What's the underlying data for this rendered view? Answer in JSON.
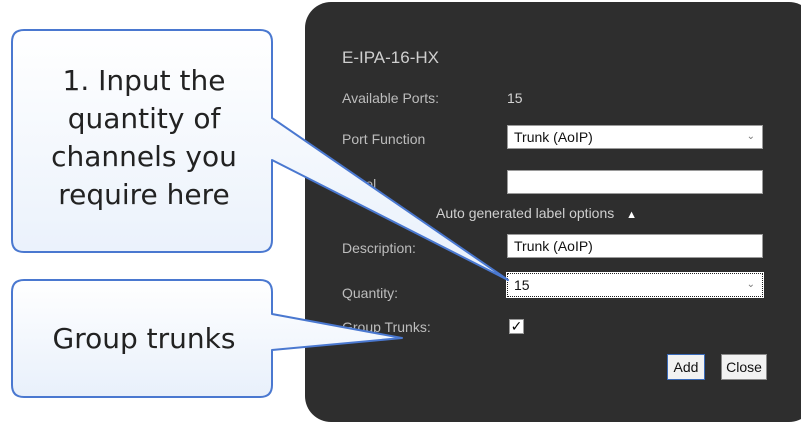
{
  "dialog": {
    "device_name": "E-IPA-16-HX",
    "available_ports_label": "Available Ports:",
    "available_ports_value": "15",
    "port_function_label": "Port Function",
    "port_function_value": "Trunk (AoIP)",
    "label_label": "Label",
    "label_value": "",
    "auto_label_options": "Auto generated label options",
    "description_label": "Description:",
    "description_value": "Trunk (AoIP)",
    "quantity_label": "Quantity:",
    "quantity_value": "15",
    "group_trunks_label": "Group Trunks:",
    "group_trunks_checked": true,
    "add_button": "Add",
    "close_button": "Close"
  },
  "callouts": {
    "input_quantity_line1": "1. Input the",
    "input_quantity_line2": "quantity of",
    "input_quantity_line3": "channels you",
    "input_quantity_line4": "require here",
    "group_trunks": "Group trunks"
  },
  "colors": {
    "panel_bg": "#2e2e2e",
    "callout_fill": "#f3f7fd",
    "callout_border": "#4a78d0"
  },
  "icons": {
    "select_chevron": "chevron-down-icon",
    "collapse_caret": "chevron-up-icon",
    "checkmark": "checkmark-icon"
  }
}
